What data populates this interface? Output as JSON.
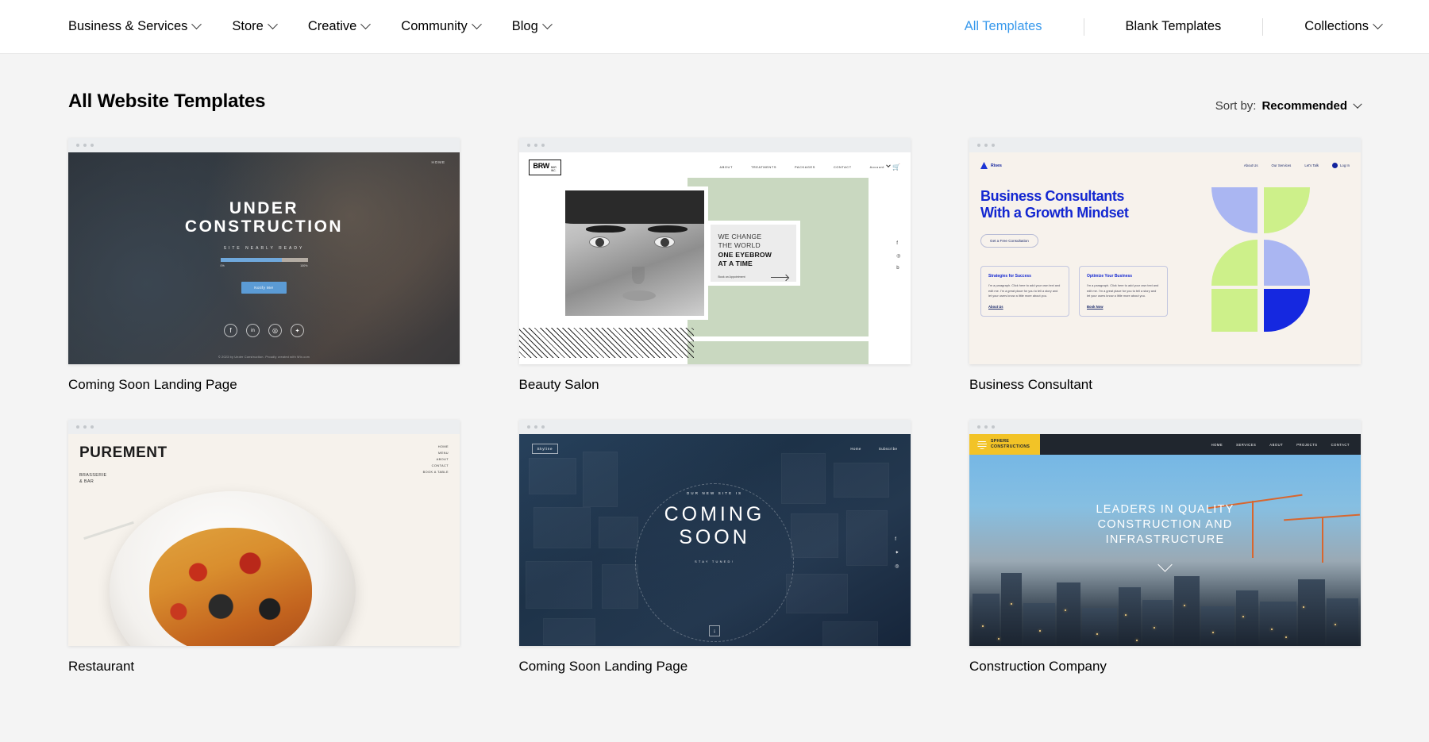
{
  "nav": {
    "left_items": [
      {
        "label": "Business & Services",
        "has_chevron": true
      },
      {
        "label": "Store",
        "has_chevron": true
      },
      {
        "label": "Creative",
        "has_chevron": true
      },
      {
        "label": "Community",
        "has_chevron": true
      },
      {
        "label": "Blog",
        "has_chevron": true
      }
    ],
    "right_items": [
      {
        "label": "All Templates",
        "active": true,
        "has_chevron": false
      },
      {
        "label": "Blank Templates",
        "active": false,
        "has_chevron": false
      },
      {
        "label": "Collections",
        "active": false,
        "has_chevron": true
      }
    ],
    "active_color": "#3899ec"
  },
  "page": {
    "title": "All Website Templates",
    "sort_label": "Sort by:",
    "sort_value": "Recommended"
  },
  "templates": [
    {
      "title": "Coming Soon Landing Page",
      "preview": {
        "nav_home": "HOME",
        "heading_line1": "UNDER",
        "heading_line2": "CONSTRUCTION",
        "subtitle": "SITE NEARLY READY",
        "progress_min": "0%",
        "progress_max": "100%",
        "progress_percent": 70,
        "button": "Notify Me!",
        "social_icons": [
          "facebook-icon",
          "linkedin-icon",
          "instagram-icon",
          "twitter-icon"
        ],
        "footer": "© 2023 by Under Construction. Proudly created with Wix.com"
      }
    },
    {
      "title": "Beauty Salon",
      "preview": {
        "logo_main": "BRW",
        "logo_sub1": "BAR",
        "logo_sub2": "INC.",
        "nav": [
          "ABOUT",
          "TREATMENTS",
          "PACKAGES",
          "CONTACT"
        ],
        "cart_label": "Account",
        "quote_line1": "WE CHANGE",
        "quote_line2": "THE WORLD",
        "quote_line3": "ONE EYEBROW",
        "quote_line4": "AT A TIME",
        "cta": "Book an Appointment",
        "social_icons": [
          "facebook-icon",
          "instagram-icon",
          "blogger-icon"
        ]
      }
    },
    {
      "title": "Business Consultant",
      "preview": {
        "brand": "Rises",
        "nav": [
          "About Us",
          "Our Services",
          "Let's Talk"
        ],
        "login": "Log In",
        "heading_line1": "Business Consultants",
        "heading_line2": "With a Growth Mindset",
        "cta": "Get a Free Consultation",
        "cards": [
          {
            "title": "Strategies for Success",
            "body": "I'm a paragraph. Click here to add your own text and edit me. I'm a great place for you to tell a story and let your users know a little more about you.",
            "link": "About Us"
          },
          {
            "title": "Optimize Your Business",
            "body": "I'm a paragraph. Click here to add your own text and edit me. I'm a great place for you to tell a story and let your users know a little more about you.",
            "link": "Book Now"
          }
        ],
        "shape_colors": [
          "#aab6f2",
          "#cdf08a",
          "#1528e0"
        ]
      }
    },
    {
      "title": "Restaurant",
      "preview": {
        "logo": "PUREMENT",
        "tagline_line1": "BRASSERIE",
        "tagline_line2": "& BAR",
        "nav": [
          "HOME",
          "MENU",
          "ABOUT",
          "CONTACT",
          "BOOK A TABLE"
        ]
      }
    },
    {
      "title": "Coming Soon Landing Page",
      "preview": {
        "logo": "Skyline",
        "nav": [
          "Home",
          "Subscribe"
        ],
        "pre_heading": "OUR NEW SITE IS",
        "heading_line1": "COMING",
        "heading_line2": "SOON",
        "post_heading": "STAY TUNED!",
        "social_icons": [
          "facebook-icon",
          "twitter-icon",
          "instagram-icon"
        ],
        "scroll_icon": "arrow-down-icon"
      }
    },
    {
      "title": "Construction Company",
      "preview": {
        "logo_line1": "SPHERE",
        "logo_line2": "CONSTRUCTIONS",
        "logo_color": "#f2c327",
        "nav": [
          "HOME",
          "SERVICES",
          "ABOUT",
          "PROJECTS",
          "CONTACT"
        ],
        "heading_line1": "LEADERS IN QUALITY",
        "heading_line2": "CONSTRUCTION AND",
        "heading_line3": "INFRASTRUCTURE",
        "scroll_icon": "chevron-down-icon"
      }
    }
  ]
}
